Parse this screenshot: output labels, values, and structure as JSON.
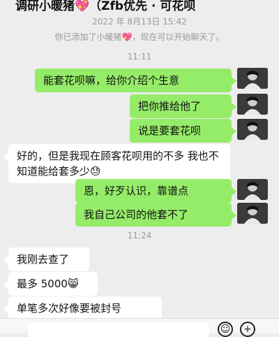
{
  "header": {
    "title": "调研小暖猪💖（Zfb优先 · 可花呗"
  },
  "meta": {
    "date": "2022 年 8月13日 15:42"
  },
  "system": {
    "added": "你已添加了小暖猪💖，现在可以开始聊天了。"
  },
  "times": [
    "11:11",
    "11:24"
  ],
  "messages": [
    {
      "side": "out",
      "text": "能套花呗嘛，给你介绍个生意"
    },
    {
      "side": "out",
      "text": "把你推给他了"
    },
    {
      "side": "out",
      "text": "说是要套花呗"
    },
    {
      "side": "in",
      "text": "好的，但是我现在顾客花呗用的不多 我也不知道能给套多少😓"
    },
    {
      "side": "out",
      "text": "恩，好歹认识，靠谱点"
    },
    {
      "side": "out",
      "text": "我自己公司的他套不了"
    },
    {
      "side": "in",
      "text": "我刚去查了"
    },
    {
      "side": "in",
      "text": "最多 5000😸"
    },
    {
      "side": "in",
      "text": "单笔多次好像要被封号"
    }
  ],
  "icons": {
    "emoji": "emoji-icon",
    "add": "add-icon"
  },
  "colors": {
    "background": "#ededed",
    "outgoing_bubble": "#95ec69",
    "incoming_bubble": "#ffffff",
    "meta_text": "#9a9a9a"
  }
}
